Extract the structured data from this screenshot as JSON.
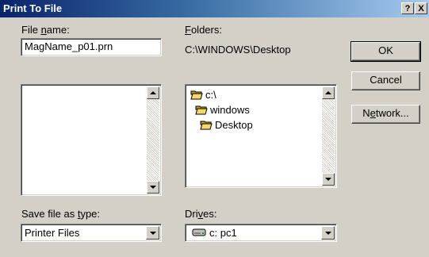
{
  "window": {
    "title": "Print To File",
    "help_button": "?",
    "close_button": "X"
  },
  "file_name": {
    "label_pre": "File ",
    "label_key": "n",
    "label_post": "ame:",
    "value": "MagName_p01.prn"
  },
  "folders": {
    "label_key": "F",
    "label_post": "olders:",
    "current_path": "C:\\WINDOWS\\Desktop",
    "items": [
      "c:\\",
      "windows",
      "Desktop"
    ]
  },
  "save_type": {
    "label_pre": "Save file as ",
    "label_key": "t",
    "label_post": "ype:",
    "value": "Printer Files"
  },
  "drives": {
    "label_pre": "Dri",
    "label_key": "v",
    "label_post": "es:",
    "value": "c: pc1"
  },
  "buttons": {
    "ok": "OK",
    "cancel": "Cancel",
    "network_pre": "N",
    "network_key": "e",
    "network_post": "twork..."
  },
  "icons": {
    "folder": "folder-icon",
    "open_folder": "open-folder-icon",
    "drive": "hard-drive-icon",
    "scroll_up": "scroll-up-arrow-icon",
    "scroll_down": "scroll-down-arrow-icon",
    "dropdown": "dropdown-arrow-icon"
  },
  "colors": {
    "dialog_bg": "#d4d0c8",
    "title_bar_start": "#0a246a",
    "title_bar_end": "#a6caf0",
    "folder_yellow": "#f5d76e"
  }
}
